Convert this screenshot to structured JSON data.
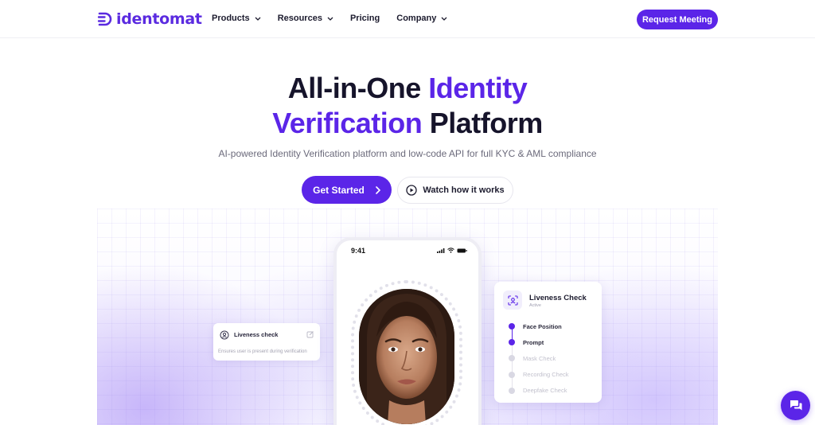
{
  "brand": {
    "name": "identomat",
    "accent": "#5b25e8"
  },
  "nav": {
    "items": [
      {
        "label": "Products",
        "has_dropdown": true
      },
      {
        "label": "Resources",
        "has_dropdown": true
      },
      {
        "label": "Pricing",
        "has_dropdown": false
      },
      {
        "label": "Company",
        "has_dropdown": true
      }
    ],
    "cta_label": "Request Meeting"
  },
  "hero": {
    "title_part1": "All-in-One ",
    "title_highlight1": "Identity",
    "title_highlight2": "Verification",
    "title_part2": " Platform",
    "subtitle": "AI-powered Identity Verification platform and low-code API for full KYC & AML compliance",
    "primary_cta": "Get Started",
    "secondary_cta": "Watch how it works"
  },
  "phone": {
    "time": "9:41"
  },
  "small_card": {
    "title": "Liveness check",
    "description": "Ensures user is present during verification"
  },
  "check_card": {
    "title": "Liveness Check",
    "status": "Active",
    "steps": [
      {
        "label": "Face Position",
        "done": true
      },
      {
        "label": "Prompt",
        "done": true
      },
      {
        "label": "Mask Check",
        "done": false
      },
      {
        "label": "Recording Check",
        "done": false
      },
      {
        "label": "Deepfake Check",
        "done": false
      }
    ]
  },
  "icons": {
    "logo": "identomat-logo-icon",
    "chevron": "chevron-down-icon",
    "arrow": "chevron-right-icon",
    "play": "play-circle-icon",
    "chat": "chat-icon"
  }
}
